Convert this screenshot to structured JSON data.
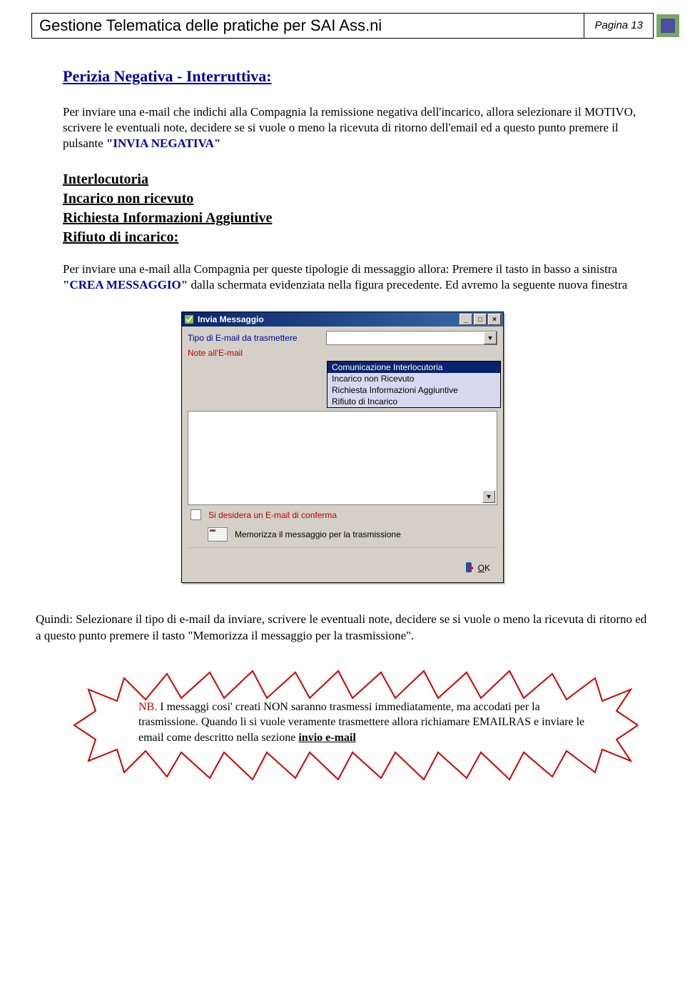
{
  "header": {
    "title": "Gestione Telematica delle pratiche per SAI Ass.ni",
    "page_label": "Pagina 13"
  },
  "section": {
    "title": "Perizia Negativa - Interruttiva:",
    "para1_a": "Per inviare una e-mail che indichi alla Compagnia la remissione negativa dell'incarico, allora selezionare il MOTIVO, scrivere le eventuali note, decidere se si vuole o meno la ricevuta di ritorno dell'email ed a questo punto premere il pulsante ",
    "para1_b": "\"INVIA NEGATIVA\"",
    "sub_headings": [
      "Interlocutoria",
      "Incarico non ricevuto",
      "Richiesta Informazioni Aggiuntive",
      "Rifiuto di incarico:"
    ],
    "para2_a": "Per inviare una e-mail alla Compagnia per queste tipologie di messaggio allora: Premere il tasto  in basso a sinistra ",
    "para2_b": "\"CREA MESSAGGIO\"",
    "para2_c": " dalla schermata evidenziata nella figura precedente. Ed avremo la seguente nuova finestra"
  },
  "dialog": {
    "title": "Invia Messaggio",
    "label_type": "Tipo di E-mail da trasmettere",
    "label_notes": "Note all'E-mail",
    "options": [
      "Comunicazione Interlocutoria",
      "Incarico non Ricevuto",
      "Richiesta Informazioni Aggiuntive",
      "Rifiuto di Incarico"
    ],
    "confirm_label": "Si desidera un E-mail di conferma",
    "memo_label": "Memorizza il messaggio per la trasmissione",
    "ok_label": "OK",
    "ok_underline": "O"
  },
  "footer_para": "Quindi: Selezionare il tipo di e-mail da inviare, scrivere le eventuali note, decidere se si vuole o meno la ricevuta di ritorno ed a questo punto premere il tasto \"Memorizza il messaggio per la trasmissione\".",
  "note": {
    "nb": "NB.",
    "text_a": " I messaggi cosi' creati NON saranno trasmessi immediatamente, ma accodati per la trasmissione. Quando li si vuole veramente trasmettere allora richiamare EMAILRAS e inviare le email come descritto nella sezione ",
    "text_b": "invio e-mail"
  }
}
